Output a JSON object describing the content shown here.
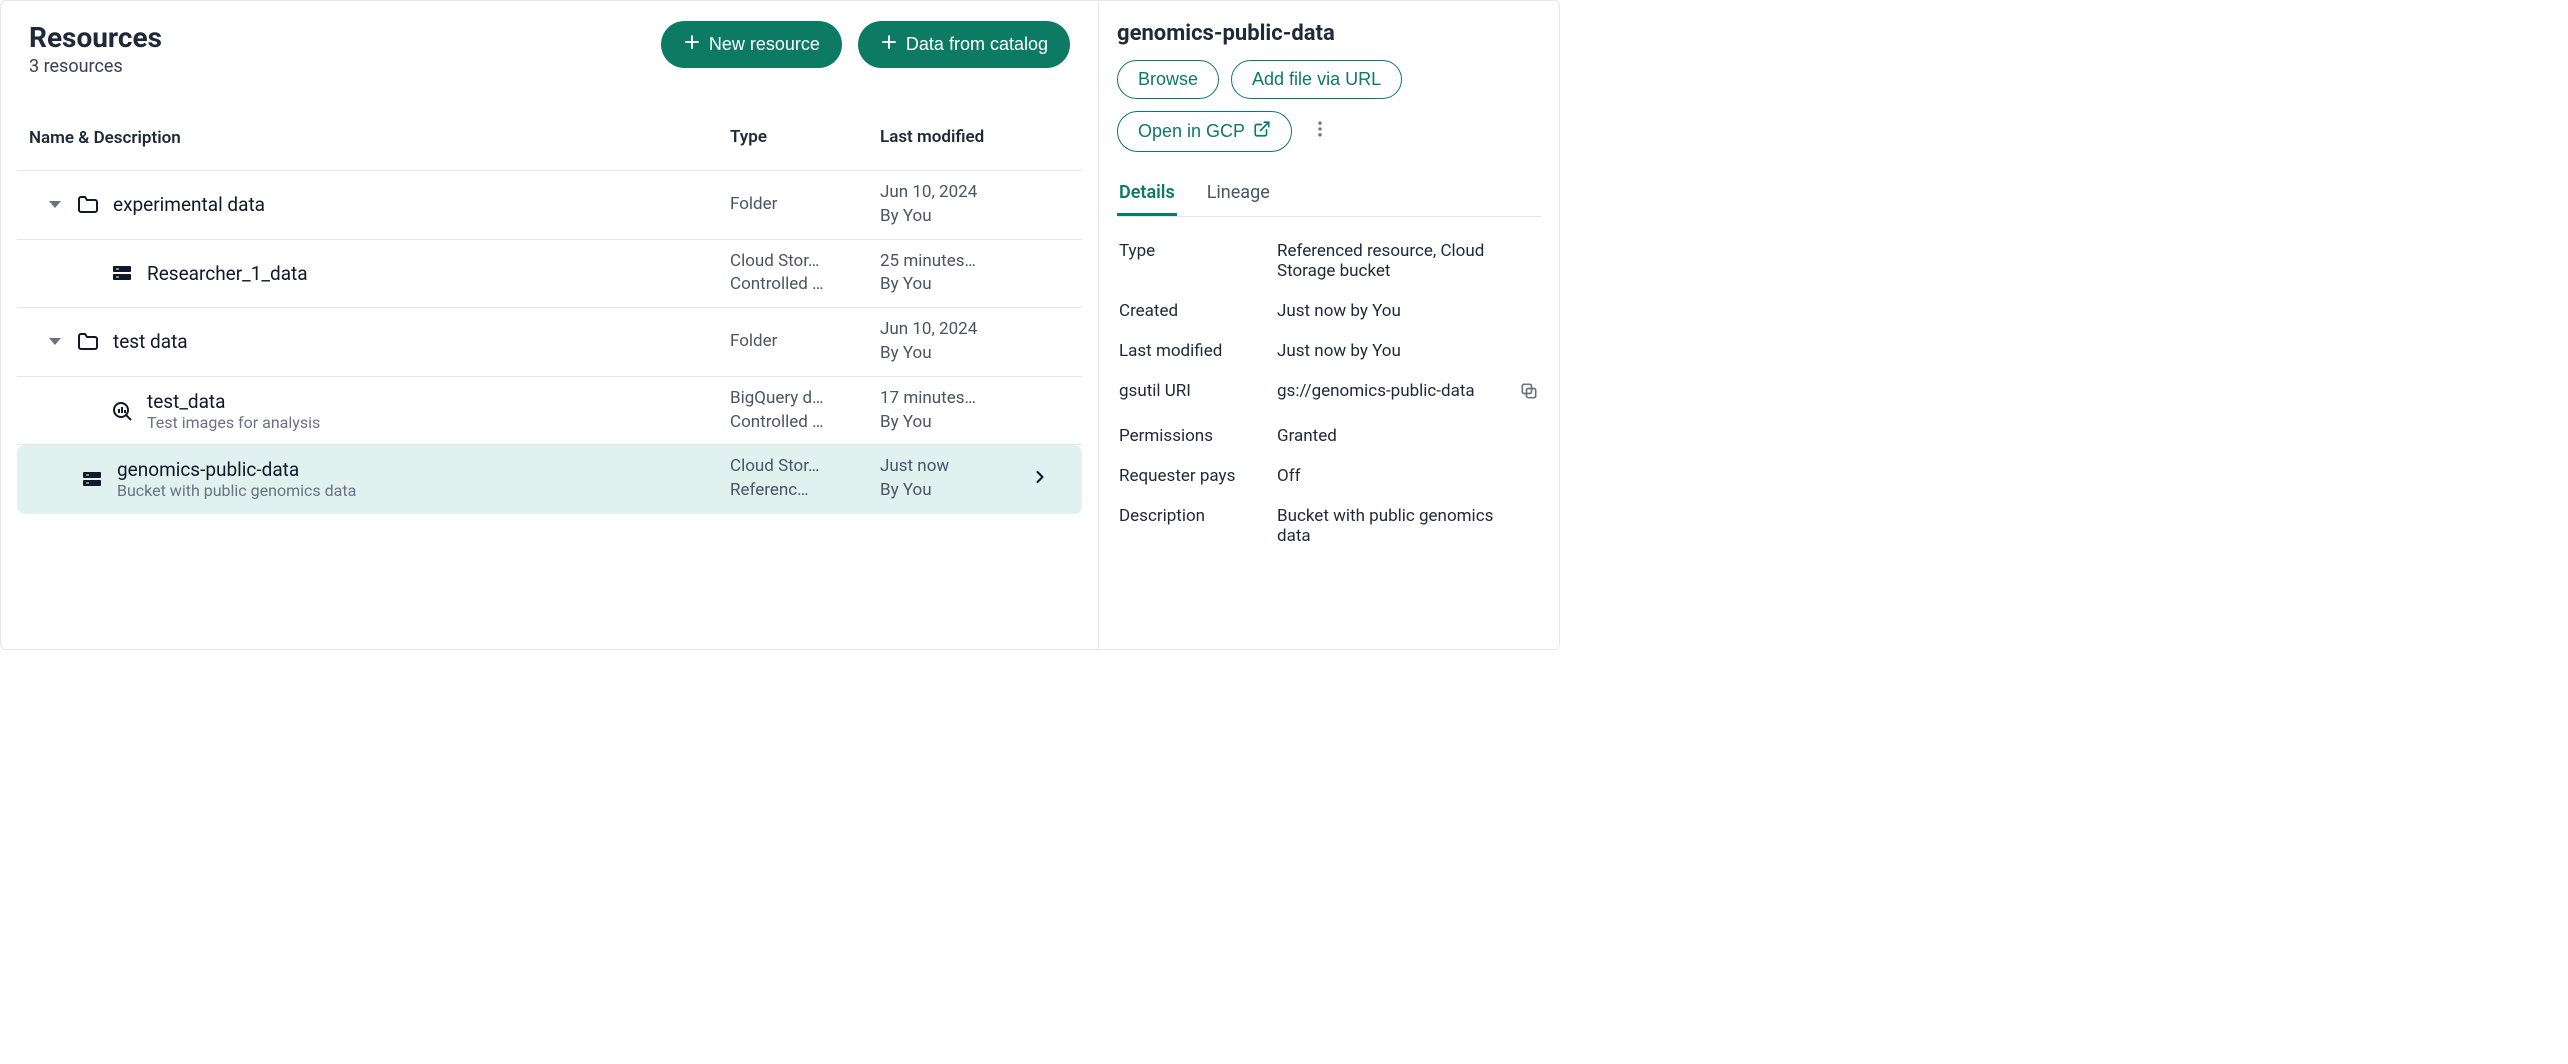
{
  "header": {
    "title": "Resources",
    "subtitle": "3 resources",
    "new_resource_label": "New resource",
    "data_from_catalog_label": "Data from catalog"
  },
  "columns": {
    "name": "Name & Description",
    "type": "Type",
    "modified": "Last modified"
  },
  "rows": [
    {
      "kind": "folder",
      "expanded": true,
      "name": "experimental data",
      "description": "",
      "type1": "Folder",
      "type2": "",
      "mod1": "Jun 10, 2024",
      "mod2": "By You"
    },
    {
      "kind": "storage",
      "child": true,
      "name": "Researcher_1_data",
      "description": "",
      "type1": "Cloud Stor…",
      "type2": "Controlled …",
      "mod1": "25 minutes…",
      "mod2": "By You"
    },
    {
      "kind": "folder",
      "expanded": true,
      "name": "test data",
      "description": "",
      "type1": "Folder",
      "type2": "",
      "mod1": "Jun 10, 2024",
      "mod2": "By You"
    },
    {
      "kind": "bigquery",
      "child": true,
      "name": "test_data",
      "description": "Test images for analysis",
      "type1": "BigQuery d…",
      "type2": "Controlled …",
      "mod1": "17 minutes…",
      "mod2": "By You"
    },
    {
      "kind": "storage",
      "child": true,
      "selected": true,
      "name": "genomics-public-data",
      "description": "Bucket with public genomics data",
      "type1": "Cloud Stor…",
      "type2": "Referenc…",
      "mod1": "Just now",
      "mod2": "By You"
    }
  ],
  "panel": {
    "title": "genomics-public-data",
    "browse_label": "Browse",
    "add_url_label": "Add file via URL",
    "open_gcp_label": "Open in GCP",
    "tabs": {
      "details": "Details",
      "lineage": "Lineage"
    },
    "details": {
      "type_k": "Type",
      "type_v": "Referenced resource, Cloud Storage bucket",
      "created_k": "Created",
      "created_v": "Just now by You",
      "modified_k": "Last modified",
      "modified_v": "Just now by You",
      "gsutil_k": "gsutil URI",
      "gsutil_v": "gs://genomics-public-data",
      "perm_k": "Permissions",
      "perm_v": "Granted",
      "req_k": "Requester pays",
      "req_v": "Off",
      "desc_k": "Description",
      "desc_v": "Bucket with public genomics data"
    }
  }
}
